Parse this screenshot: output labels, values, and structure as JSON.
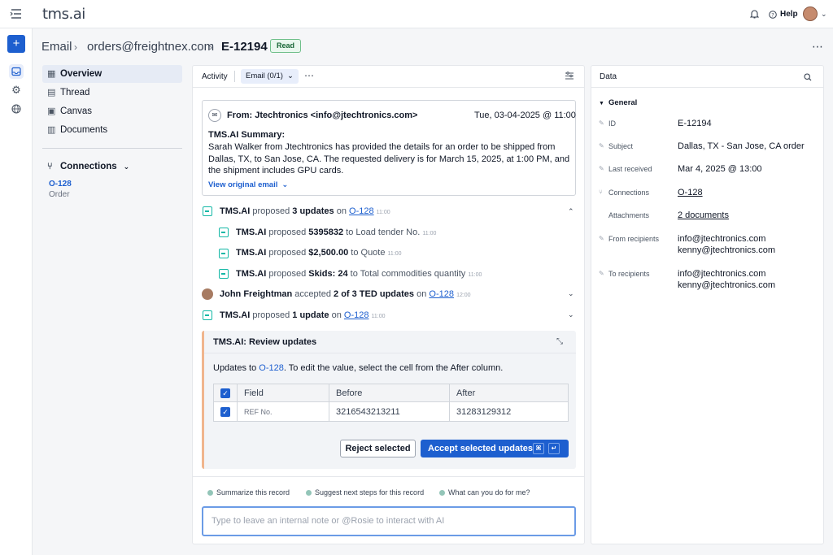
{
  "app": {
    "logo": "tms.ai",
    "help_label": "Help"
  },
  "breadcrumb": {
    "item1": "Email",
    "item2": "orders@freightnex.com",
    "item3": "E-12194",
    "status": "Read"
  },
  "left_nav": {
    "items": [
      "Overview",
      "Thread",
      "Canvas",
      "Documents"
    ],
    "connections_label": "Connections",
    "connection_id": "O-128",
    "connection_type": "Order"
  },
  "activity": {
    "tab_activity": "Activity",
    "tab_email": "Email (0/1)",
    "email": {
      "from": "From: Jtechtronics <info@jtechtronics.com>",
      "date": "Tue, 03-04-2025 @ 11:00",
      "summary_title": "TMS.AI Summary:",
      "summary_text": "Sarah Walker from Jtechtronics has provided the details for an order to be shipped from Dallas, TX, to San Jose, CA. The requested delivery is for March 15, 2025, at 1:00 PM, and the shipment includes GPU cards.",
      "view_original": "View original email"
    },
    "events": [
      {
        "actor": "TMS.AI",
        "verb": "proposed",
        "obj": "3 updates",
        "on": "on",
        "link": "O-128",
        "time": "11:00"
      },
      {
        "actor": "TMS.AI",
        "verb": "proposed",
        "obj": "5395832",
        "to": "to Load tender No.",
        "time": "11:00"
      },
      {
        "actor": "TMS.AI",
        "verb": "proposed",
        "obj": "$2,500.00",
        "to": "to Quote",
        "time": "11:00"
      },
      {
        "actor": "TMS.AI",
        "verb": "proposed",
        "obj": "Skids: 24",
        "to": "to Total commodities quantity",
        "time": "11:00"
      },
      {
        "actor": "John Freightman",
        "verb": "accepted",
        "obj": "2 of 3 TED updates",
        "on": "on",
        "link": "O-128",
        "time": "12:00"
      },
      {
        "actor": "TMS.AI",
        "verb": "proposed",
        "obj": "1 update",
        "on": "on",
        "link": "O-128",
        "time": "11:00"
      }
    ],
    "review": {
      "title": "TMS.AI: Review updates",
      "desc_prefix": "Updates to",
      "desc_link": "O-128",
      "desc_suffix": ". To edit the value, select the cell from the After column.",
      "col_field": "Field",
      "col_before": "Before",
      "col_after": "After",
      "row_field": "REF No.",
      "row_before": "3216543213211",
      "row_after": "31283129312",
      "reject_label": "Reject selected",
      "accept_label": "Accept selected updates",
      "shortcut1": "⌘",
      "shortcut2": "↵"
    },
    "suggestions": [
      "Summarize this record",
      "Suggest next steps for this record",
      "What can you do for me?"
    ],
    "input_placeholder": "Type to leave an internal note or @Rosie to interact with AI"
  },
  "data_panel": {
    "title": "Data",
    "section": "General",
    "fields": [
      {
        "label": "ID",
        "value": "E-12194"
      },
      {
        "label": "Subject",
        "value": "Dallas, TX - San Jose, CA order"
      },
      {
        "label": "Last received",
        "value": "Mar 4, 2025 @ 13:00"
      },
      {
        "label": "Connections",
        "value": "O-128"
      },
      {
        "label": "Attachments",
        "value": "2 documents"
      },
      {
        "label": "From recipients",
        "value": "info@jtechtronics.com",
        "value2": "kenny@jtechtronics.com"
      },
      {
        "label": "To recipients",
        "value": "info@jtechtronics.com",
        "value2": "kenny@jtechtronics.com"
      }
    ]
  },
  "colors": {
    "accent": "#1d5fcf",
    "teal": "#14b8a6",
    "status_green": "#166534"
  },
  "icons": [
    "menu-icon",
    "plus-icon",
    "inbox-icon",
    "gear-icon",
    "globe-icon",
    "bell-icon",
    "help-icon",
    "more-icon",
    "filter-icon",
    "search-icon",
    "mail-icon",
    "update-icon",
    "collapse-icon"
  ]
}
